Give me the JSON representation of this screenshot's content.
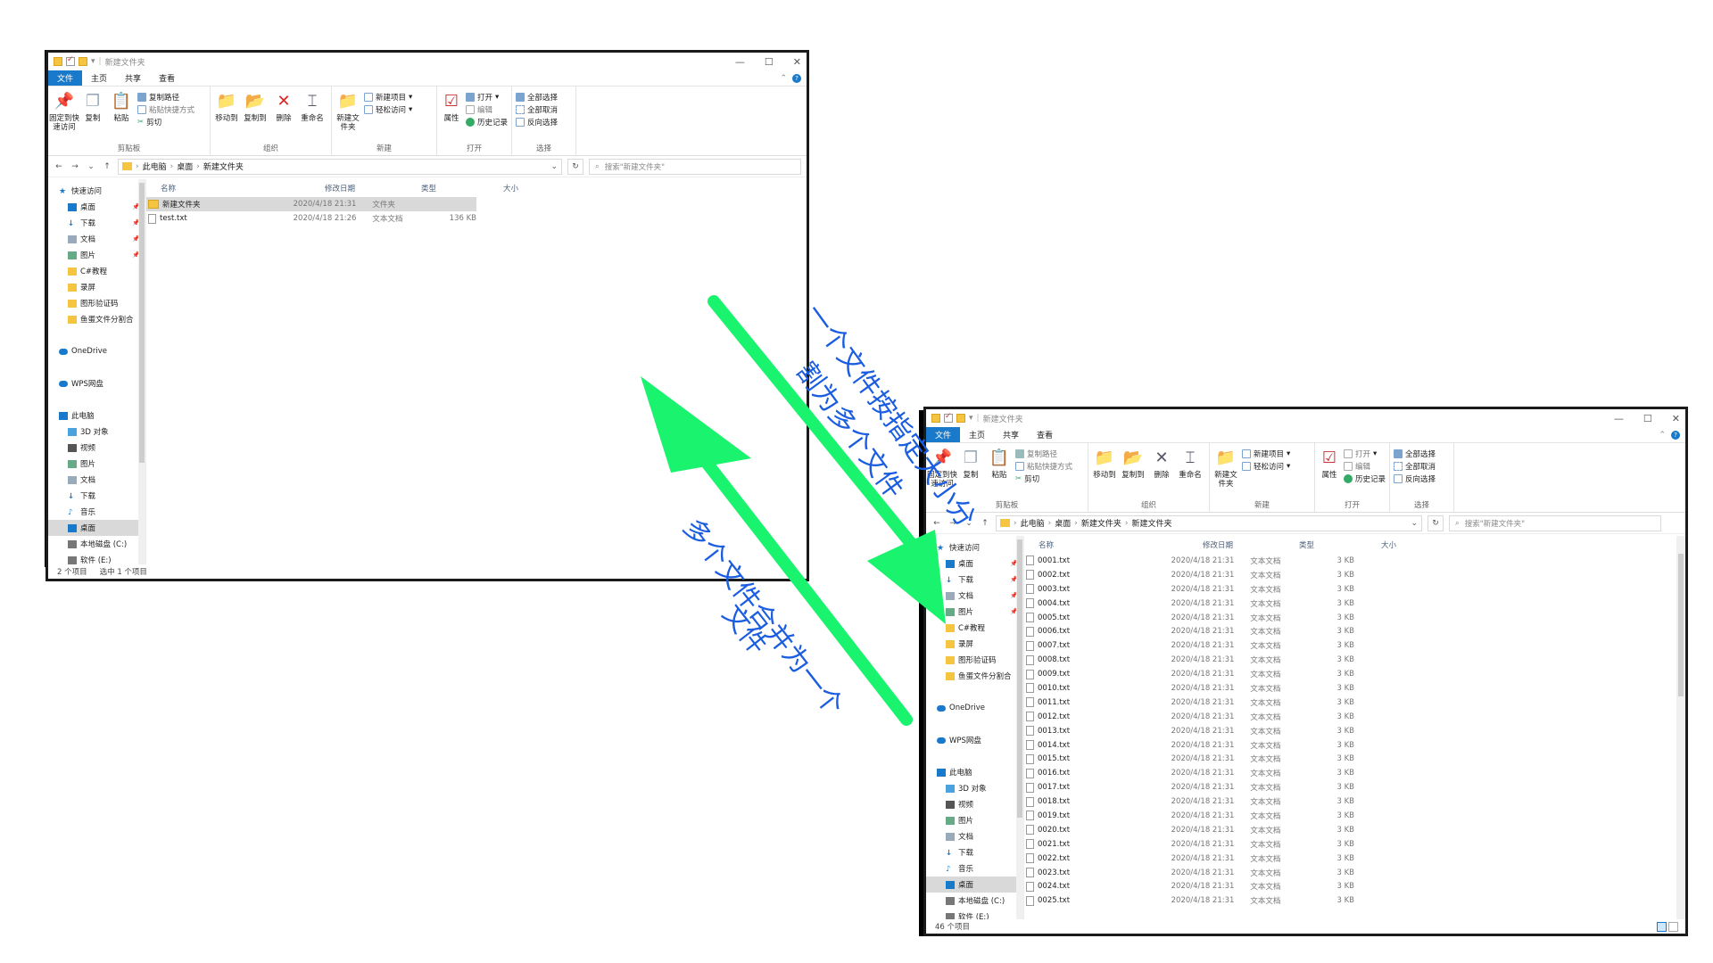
{
  "colors": {
    "accent": "#1979ca",
    "arrow": "#19f36e",
    "annotation": "#1a5de0",
    "selection": "#d9d9d9",
    "folder": "#f5c542"
  },
  "win1": {
    "title": "新建文件夹",
    "tabs": [
      "文件",
      "主页",
      "共享",
      "查看"
    ],
    "ribbon": {
      "clipboard": {
        "pin": "固定到快速访问",
        "copy": "复制",
        "paste": "粘贴",
        "copy_path": "复制路径",
        "paste_shortcut": "粘贴快捷方式",
        "cut": "剪切",
        "label": "剪贴板"
      },
      "organize": {
        "move_to": "移动到",
        "copy_to": "复制到",
        "delete": "删除",
        "rename": "重命名",
        "label": "组织"
      },
      "new": {
        "new_folder": "新建文件夹",
        "new_item": "新建项目",
        "easy_access": "轻松访问",
        "label": "新建"
      },
      "open": {
        "properties": "属性",
        "open": "打开",
        "edit": "编辑",
        "history": "历史记录",
        "label": "打开"
      },
      "select": {
        "select_all": "全部选择",
        "select_none": "全部取消",
        "invert": "反向选择",
        "label": "选择"
      }
    },
    "address": {
      "crumbs": [
        "此电脑",
        "桌面",
        "新建文件夹"
      ],
      "search_placeholder": "搜索\"新建文件夹\""
    },
    "nav": [
      {
        "label": "快速访问",
        "icon": "star-icon",
        "color": "#1979ca",
        "pin": false
      },
      {
        "label": "桌面",
        "icon": "desktop-icon",
        "color": "#1979ca",
        "pin": true
      },
      {
        "label": "下载",
        "icon": "download-icon",
        "color": "#1979ca",
        "pin": true
      },
      {
        "label": "文档",
        "icon": "document-icon",
        "color": "#9ab",
        "pin": true
      },
      {
        "label": "图片",
        "icon": "picture-icon",
        "color": "#6a8",
        "pin": true
      },
      {
        "label": "C#教程",
        "icon": "folder-icon",
        "color": "#f5c542",
        "pin": false
      },
      {
        "label": "录屏",
        "icon": "folder-icon",
        "color": "#f5c542",
        "pin": false
      },
      {
        "label": "图形验证码",
        "icon": "folder-icon",
        "color": "#f5c542",
        "pin": false
      },
      {
        "label": "鱼蛋文件分割合",
        "icon": "folder-icon",
        "color": "#f5c542",
        "pin": false
      },
      {
        "label": "",
        "icon": "",
        "color": "",
        "pin": false
      },
      {
        "label": "OneDrive",
        "icon": "cloud-icon",
        "color": "#1979ca",
        "pin": false
      },
      {
        "label": "",
        "icon": "",
        "color": "",
        "pin": false
      },
      {
        "label": "WPS网盘",
        "icon": "cloud-outline-icon",
        "color": "#1979ca",
        "pin": false
      },
      {
        "label": "",
        "icon": "",
        "color": "",
        "pin": false
      },
      {
        "label": "此电脑",
        "icon": "computer-icon",
        "color": "#1979ca",
        "pin": false
      },
      {
        "label": "3D 对象",
        "icon": "cube-icon",
        "color": "#4aa3df",
        "pin": false
      },
      {
        "label": "视频",
        "icon": "video-icon",
        "color": "#555",
        "pin": false
      },
      {
        "label": "图片",
        "icon": "picture-icon",
        "color": "#6a8",
        "pin": false
      },
      {
        "label": "文档",
        "icon": "document-icon",
        "color": "#9ab",
        "pin": false
      },
      {
        "label": "下载",
        "icon": "download-icon",
        "color": "#1979ca",
        "pin": false
      },
      {
        "label": "音乐",
        "icon": "music-icon",
        "color": "#1979ca",
        "pin": false
      },
      {
        "label": "桌面",
        "icon": "desktop-icon",
        "color": "#1979ca",
        "pin": false,
        "selected": true
      },
      {
        "label": "本地磁盘 (C:)",
        "icon": "drive-icon",
        "color": "#777",
        "pin": false
      },
      {
        "label": "软件 (E:)",
        "icon": "drive-icon",
        "color": "#777",
        "pin": false
      }
    ],
    "columns": {
      "name": "名称",
      "date": "修改日期",
      "type": "类型",
      "size": "大小"
    },
    "files": [
      {
        "name": "新建文件夹",
        "date": "2020/4/18 21:31",
        "type": "文件夹",
        "size": "",
        "folder": true,
        "selected": true
      },
      {
        "name": "test.txt",
        "date": "2020/4/18 21:26",
        "type": "文本文档",
        "size": "136 KB",
        "folder": false,
        "selected": false
      }
    ],
    "status": {
      "count": "2 个项目",
      "selected": "选中 1 个项目"
    }
  },
  "win2": {
    "title": "新建文件夹",
    "tabs": [
      "文件",
      "主页",
      "共享",
      "查看"
    ],
    "address": {
      "crumbs": [
        "此电脑",
        "桌面",
        "新建文件夹",
        "新建文件夹"
      ],
      "search_placeholder": "搜索\"新建文件夹\""
    },
    "files": [
      {
        "name": "0001.txt",
        "date": "2020/4/18 21:31",
        "type": "文本文档",
        "size": "3 KB"
      },
      {
        "name": "0002.txt",
        "date": "2020/4/18 21:31",
        "type": "文本文档",
        "size": "3 KB"
      },
      {
        "name": "0003.txt",
        "date": "2020/4/18 21:31",
        "type": "文本文档",
        "size": "3 KB"
      },
      {
        "name": "0004.txt",
        "date": "2020/4/18 21:31",
        "type": "文本文档",
        "size": "3 KB"
      },
      {
        "name": "0005.txt",
        "date": "2020/4/18 21:31",
        "type": "文本文档",
        "size": "3 KB"
      },
      {
        "name": "0006.txt",
        "date": "2020/4/18 21:31",
        "type": "文本文档",
        "size": "3 KB"
      },
      {
        "name": "0007.txt",
        "date": "2020/4/18 21:31",
        "type": "文本文档",
        "size": "3 KB"
      },
      {
        "name": "0008.txt",
        "date": "2020/4/18 21:31",
        "type": "文本文档",
        "size": "3 KB"
      },
      {
        "name": "0009.txt",
        "date": "2020/4/18 21:31",
        "type": "文本文档",
        "size": "3 KB"
      },
      {
        "name": "0010.txt",
        "date": "2020/4/18 21:31",
        "type": "文本文档",
        "size": "3 KB"
      },
      {
        "name": "0011.txt",
        "date": "2020/4/18 21:31",
        "type": "文本文档",
        "size": "3 KB"
      },
      {
        "name": "0012.txt",
        "date": "2020/4/18 21:31",
        "type": "文本文档",
        "size": "3 KB"
      },
      {
        "name": "0013.txt",
        "date": "2020/4/18 21:31",
        "type": "文本文档",
        "size": "3 KB"
      },
      {
        "name": "0014.txt",
        "date": "2020/4/18 21:31",
        "type": "文本文档",
        "size": "3 KB"
      },
      {
        "name": "0015.txt",
        "date": "2020/4/18 21:31",
        "type": "文本文档",
        "size": "3 KB"
      },
      {
        "name": "0016.txt",
        "date": "2020/4/18 21:31",
        "type": "文本文档",
        "size": "3 KB"
      },
      {
        "name": "0017.txt",
        "date": "2020/4/18 21:31",
        "type": "文本文档",
        "size": "3 KB"
      },
      {
        "name": "0018.txt",
        "date": "2020/4/18 21:31",
        "type": "文本文档",
        "size": "3 KB"
      },
      {
        "name": "0019.txt",
        "date": "2020/4/18 21:31",
        "type": "文本文档",
        "size": "3 KB"
      },
      {
        "name": "0020.txt",
        "date": "2020/4/18 21:31",
        "type": "文本文档",
        "size": "3 KB"
      },
      {
        "name": "0021.txt",
        "date": "2020/4/18 21:31",
        "type": "文本文档",
        "size": "3 KB"
      },
      {
        "name": "0022.txt",
        "date": "2020/4/18 21:31",
        "type": "文本文档",
        "size": "3 KB"
      },
      {
        "name": "0023.txt",
        "date": "2020/4/18 21:31",
        "type": "文本文档",
        "size": "3 KB"
      },
      {
        "name": "0024.txt",
        "date": "2020/4/18 21:31",
        "type": "文本文档",
        "size": "3 KB"
      },
      {
        "name": "0025.txt",
        "date": "2020/4/18 21:31",
        "type": "文本文档",
        "size": "3 KB"
      }
    ],
    "status": {
      "count": "46 个项目"
    }
  },
  "annotations": {
    "split_line1": "一个文件按指定大小分",
    "split_line2": "割为多个文件",
    "merge_line1": "多个文件合并为一个",
    "merge_line2": "文件"
  }
}
